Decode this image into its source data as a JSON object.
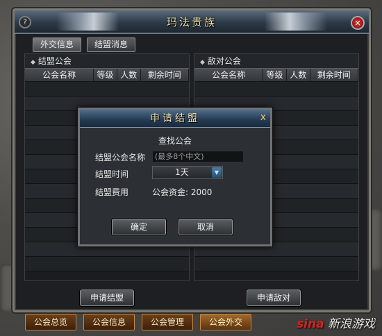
{
  "window": {
    "title": "玛法贵族",
    "help": "?",
    "close": "×"
  },
  "tabs": [
    {
      "label": "外交信息"
    },
    {
      "label": "结盟消息"
    }
  ],
  "left": {
    "heading": "结盟公会",
    "columns": [
      "公会名称",
      "等级",
      "人数",
      "剩余时间"
    ]
  },
  "right": {
    "heading": "敌对公会",
    "columns": [
      "公会名称",
      "等级",
      "人数",
      "剩余时间"
    ]
  },
  "buttons": {
    "apply_alliance": "申请结盟",
    "apply_enemy": "申请敌对"
  },
  "bottom_tabs": [
    {
      "label": "公会总览"
    },
    {
      "label": "公会信息"
    },
    {
      "label": "公会管理"
    },
    {
      "label": "公会外交"
    }
  ],
  "watermark": {
    "logo": "sina",
    "text": "新浪游戏"
  },
  "dialog": {
    "title": "申请结盟",
    "close": "x",
    "subtitle": "查找公会",
    "name_label": "结盟公会名称",
    "name_placeholder": "(最多8个中文)",
    "time_label": "结盟时间",
    "time_value": "1天",
    "fee_label": "结盟费用",
    "fee_value": "公会资金: 2000",
    "ok": "确定",
    "cancel": "取消"
  }
}
